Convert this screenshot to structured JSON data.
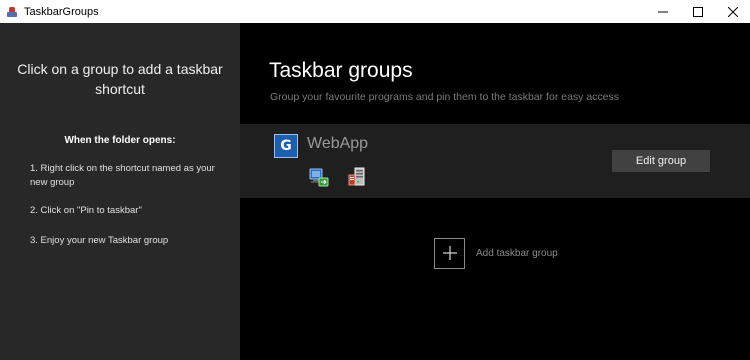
{
  "window": {
    "title": "TaskbarGroups"
  },
  "sidebar": {
    "title": "Click on a group to add a taskbar shortcut",
    "instructions_heading": "When the folder opens:",
    "steps": [
      "1. Right click on the shortcut named as your new group",
      "2. Click on \"Pin to taskbar\"",
      "3. Enjoy your new Taskbar group"
    ]
  },
  "main": {
    "title": "Taskbar groups",
    "subtitle": "Group your favourite programs and pin them to the taskbar for easy access",
    "groups": [
      {
        "name": "WebApp",
        "icon": "webapp-g-icon",
        "programs": [
          "network-computer-icon",
          "server-tower-icon"
        ],
        "edit_label": "Edit group"
      }
    ],
    "add_group_label": "Add taskbar group"
  },
  "colors": {
    "sidebar_bg": "#282828",
    "main_bg": "#000000",
    "group_row_bg": "#1f1f1f",
    "edit_button_bg": "#414141",
    "muted_text": "#7a7a7a"
  }
}
